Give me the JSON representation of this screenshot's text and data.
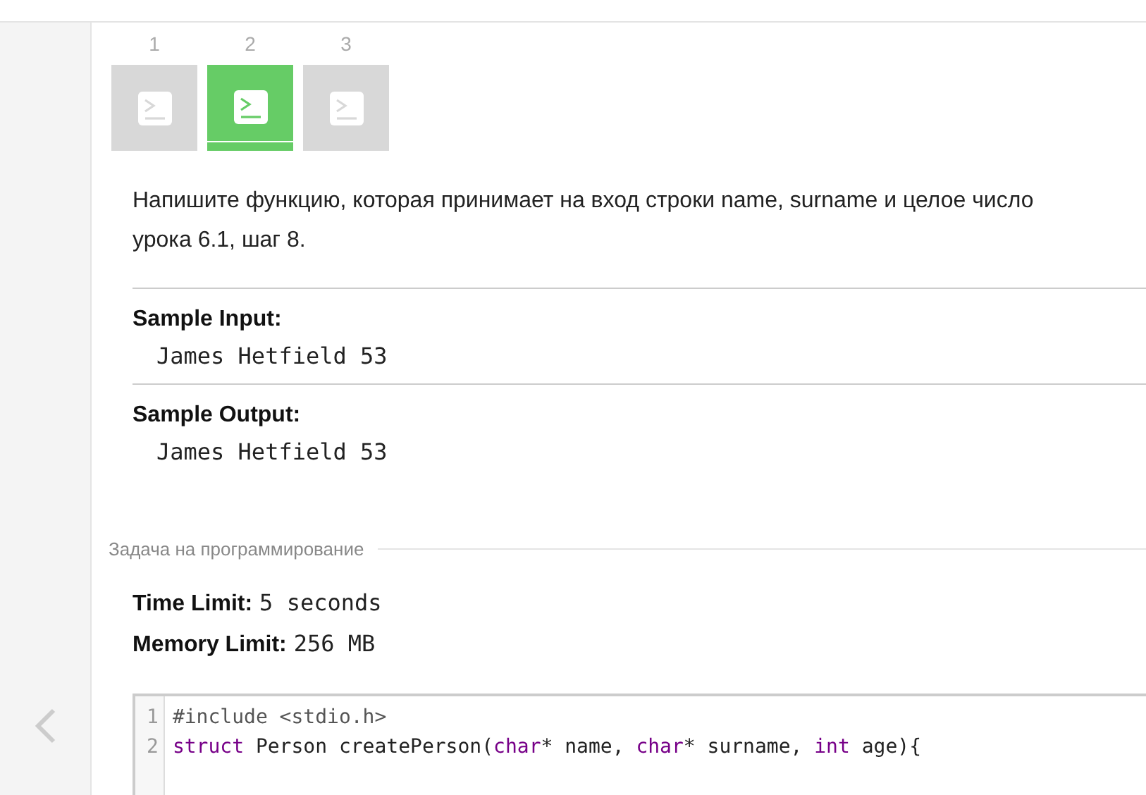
{
  "steps": [
    {
      "number": "1",
      "selected": false
    },
    {
      "number": "2",
      "selected": true
    },
    {
      "number": "3",
      "selected": false
    }
  ],
  "description": {
    "lines": [
      "Напишите функцию, которая принимает на вход строки name, surname и целое число",
      "урока 6.1, шаг 8."
    ]
  },
  "samples": [
    {
      "label": "Sample Input:",
      "value": "James Hetfield 53"
    },
    {
      "label": "Sample Output:",
      "value": "James Hetfield 53"
    }
  ],
  "section_title": "Задача на программирование",
  "limits": [
    {
      "label": "Time Limit:",
      "value": "5 seconds"
    },
    {
      "label": "Memory Limit:",
      "value": "256 MB"
    }
  ],
  "code": [
    {
      "number": "1",
      "tokens": [
        {
          "kind": "meta",
          "text": "#include <stdio.h>"
        }
      ]
    },
    {
      "number": "2",
      "tokens": [
        {
          "kind": "keyword",
          "text": "struct"
        },
        {
          "kind": "plain",
          "text": " Person createPerson("
        },
        {
          "kind": "keyword",
          "text": "char"
        },
        {
          "kind": "plain",
          "text": "* name, "
        },
        {
          "kind": "keyword",
          "text": "char"
        },
        {
          "kind": "plain",
          "text": "* surname, "
        },
        {
          "kind": "keyword",
          "text": "int"
        },
        {
          "kind": "plain",
          "text": " age){"
        }
      ]
    }
  ]
}
